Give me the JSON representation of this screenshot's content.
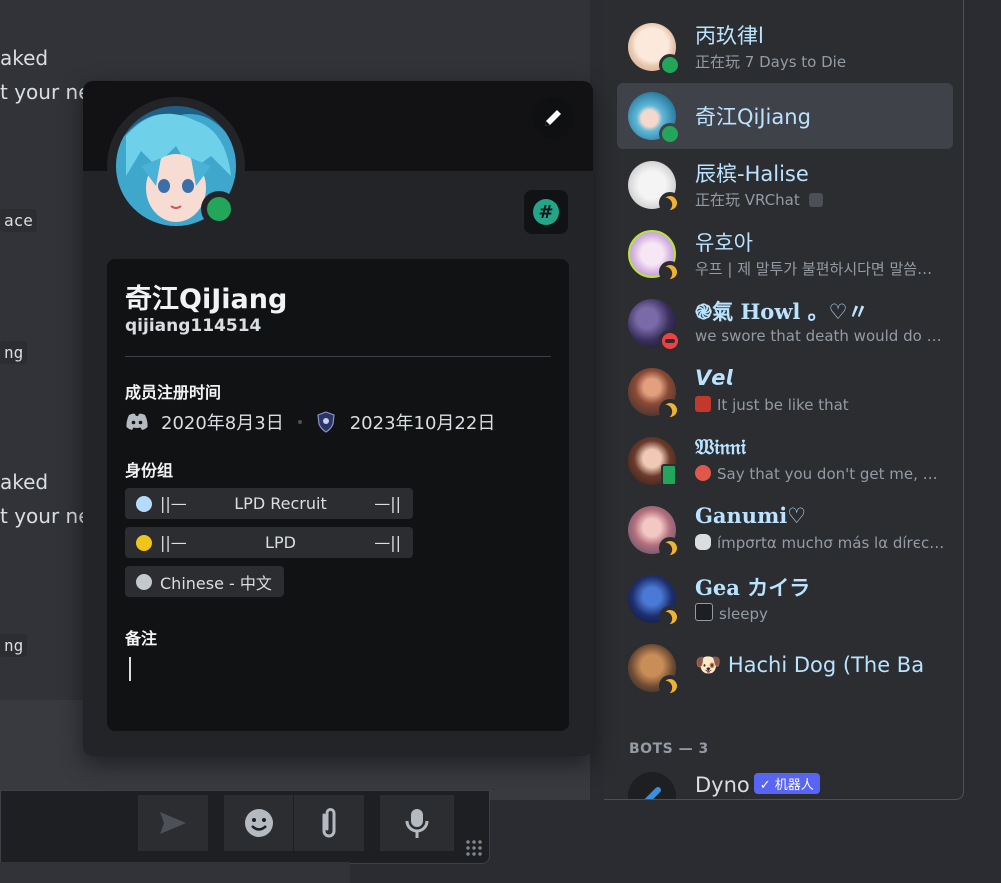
{
  "chat": {
    "fragments": [
      "aked",
      "t your ne",
      "ace",
      "ng",
      "aked",
      "t your ne",
      "ng"
    ]
  },
  "composer": {
    "icons": [
      "send-icon",
      "emoji-icon",
      "attach-icon",
      "mic-icon"
    ]
  },
  "profile": {
    "display_name": "奇江QiJiang",
    "username": "qijiang114514",
    "member_since_label": "成员注册时间",
    "discord_date": "2020年8月3日",
    "server_date": "2023年10月22日",
    "roles_label": "身份组",
    "roles": [
      {
        "prefix": "||—",
        "name": "LPD Recruit",
        "suffix": "—||",
        "color": "#b5dbfb"
      },
      {
        "prefix": "||—",
        "name": "LPD",
        "suffix": "—||",
        "color": "#f0c419"
      },
      {
        "prefix": "",
        "name": "Chinese - 中文",
        "suffix": "",
        "color": "#c4c9ce"
      }
    ],
    "note_label": "备注",
    "status": "online",
    "colors": {
      "status_online": "#23a55a",
      "badge": "#23a58a"
    }
  },
  "members": [
    {
      "name": "丙玖律l",
      "activity": "正在玩 7 Days to Die",
      "status": "online"
    },
    {
      "name": "奇江QiJiang",
      "activity": "",
      "status": "online",
      "selected": true
    },
    {
      "name": "辰槟-Halise",
      "activity": "正在玩 VRChat",
      "status": "idle"
    },
    {
      "name": "유호아",
      "activity": "우프 | 제 말투가 불편하시다면 말씀해주세요",
      "status": "idle"
    },
    {
      "name": "֎氣 Howl 。♡〃",
      "activity": "we swore that death would do us part",
      "status": "dnd"
    },
    {
      "name": "𝙑𝙚𝙡",
      "activity": "It just be like that",
      "status": "idle"
    },
    {
      "name": "𝔚𝔦𝔫𝔫𝔦",
      "activity": "Say that you don't get me, say that you",
      "status": "mobile"
    },
    {
      "name": "Ganumi♡",
      "activity": "ímpσrtα muchσ más lα dírєccíón",
      "status": "idle"
    },
    {
      "name": "Gea カイラ",
      "activity": "sleepy",
      "status": "idle"
    },
    {
      "name": "🐶 Hachi Dog (The Ba",
      "activity": "",
      "status": "idle"
    }
  ],
  "bots_header": "BOTS — 3",
  "bot": {
    "name": "Dyno",
    "badge": "✓ 机器人"
  }
}
